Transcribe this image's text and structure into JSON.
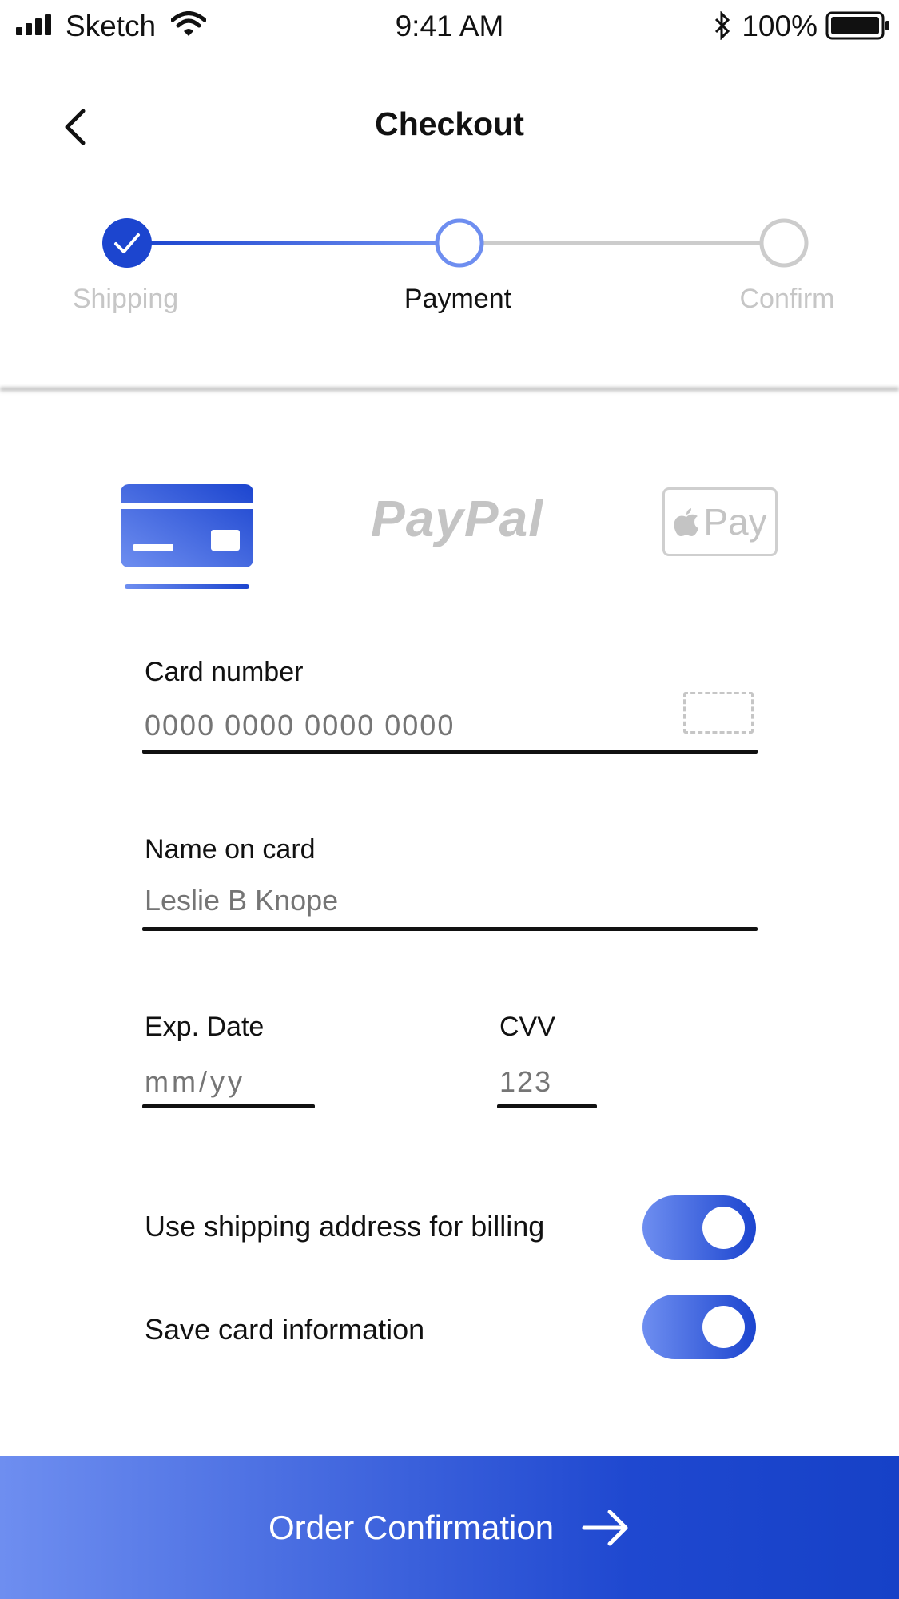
{
  "status_bar": {
    "carrier": "Sketch",
    "time": "9:41 AM",
    "battery": "100%",
    "icons": [
      "signal-bars-icon",
      "wifi-icon",
      "bluetooth-icon",
      "battery-icon"
    ]
  },
  "header": {
    "title": "Checkout",
    "back_icon": "chevron-left-icon"
  },
  "stepper": {
    "steps": [
      {
        "label": "Shipping",
        "state": "completed"
      },
      {
        "label": "Payment",
        "state": "active"
      },
      {
        "label": "Confirm",
        "state": "upcoming"
      }
    ]
  },
  "payment_methods": {
    "selected": "card",
    "items": [
      {
        "id": "card",
        "icon": "credit-card-icon"
      },
      {
        "id": "paypal",
        "label": "PayPal"
      },
      {
        "id": "applepay",
        "icon": "apple-logo-icon",
        "label": "Pay"
      }
    ]
  },
  "form": {
    "card_number": {
      "label": "Card number",
      "placeholder": "0000 0000 0000 0000",
      "icon": "card-scan-icon"
    },
    "name_on_card": {
      "label": "Name on card",
      "placeholder": "Leslie B Knope"
    },
    "exp_date": {
      "label": "Exp. Date",
      "placeholder": "mm/yy"
    },
    "cvv": {
      "label": "CVV",
      "placeholder": "123"
    }
  },
  "toggles": [
    {
      "label": "Use shipping address for billing",
      "on": true
    },
    {
      "label": "Save card information",
      "on": true
    }
  ],
  "cta": {
    "label": "Order Confirmation",
    "icon": "arrow-right-icon"
  },
  "colors": {
    "accent_dark": "#1c45cf",
    "accent_light": "#6e8ef0",
    "muted": "#c4c4c4",
    "inactive_line": "#cccccc"
  }
}
